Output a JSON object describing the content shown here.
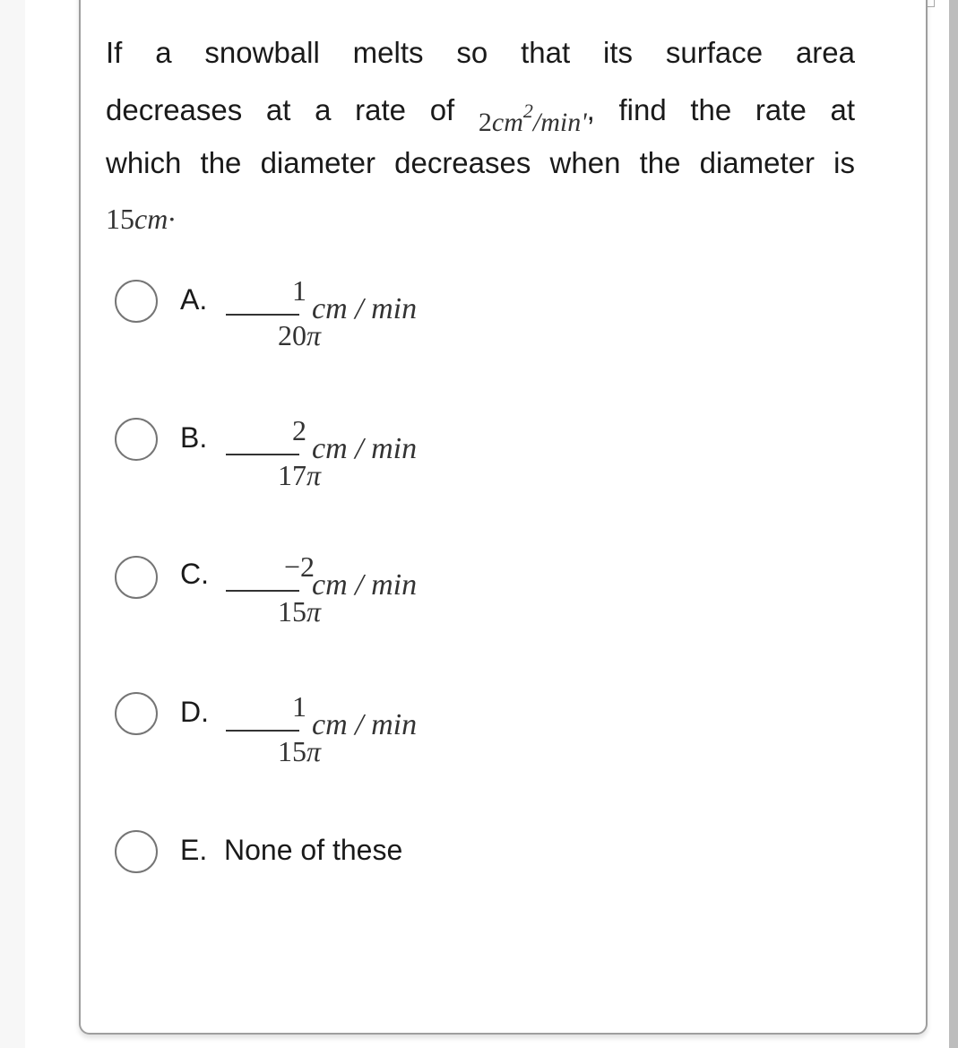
{
  "question": {
    "line1": "If a snowball melts so that its surface area",
    "line2_before": "decreases at a rate of ",
    "rate_value": "2",
    "rate_unit_base": "cm",
    "rate_unit_exp": "2",
    "rate_unit_tail": "/min",
    "rate_punct": "'",
    "line2_after": ", find the rate at",
    "line3": "which the diameter decreases when the diameter is",
    "diameter_value": "15",
    "diameter_unit": "cm",
    "diameter_punct": "·"
  },
  "options": [
    {
      "letter": "A.",
      "numerator": "1",
      "denominator": "20",
      "pi": "π",
      "unit": "cm / min",
      "selected": false
    },
    {
      "letter": "B.",
      "numerator": "2",
      "denominator": "17",
      "pi": "π",
      "unit": "cm / min",
      "selected": false
    },
    {
      "letter": "C.",
      "numerator": "−2",
      "denominator": "15",
      "pi": "π",
      "unit": "cm / min",
      "selected": false
    },
    {
      "letter": "D.",
      "numerator": "1",
      "denominator": "15",
      "pi": "π",
      "unit": "cm / min",
      "selected": false
    },
    {
      "letter": "E.",
      "text": "None of these",
      "selected": false
    }
  ]
}
